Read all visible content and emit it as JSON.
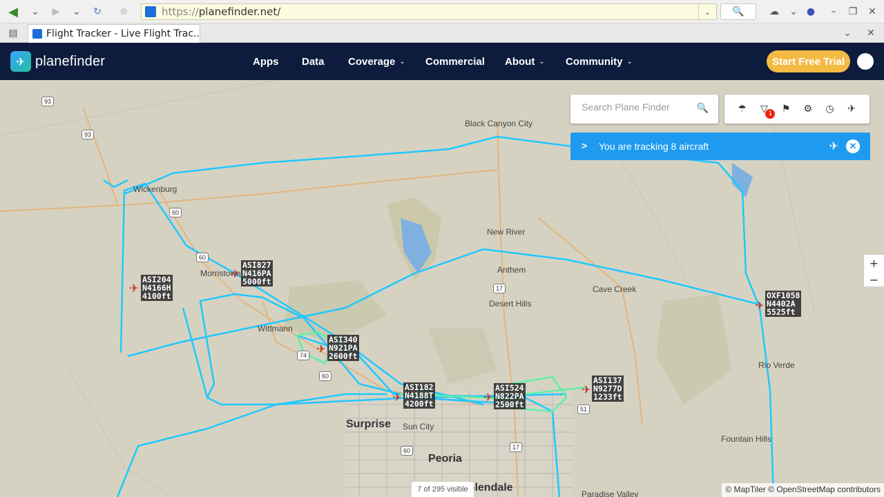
{
  "browser": {
    "url_prefix": "https://",
    "url_host": "planefinder.net/",
    "tab_title": "Flight Tracker - Live Flight Trac..."
  },
  "nav": {
    "logo": "planefinder",
    "items": [
      "Apps",
      "Data",
      "Coverage",
      "Commercial",
      "About",
      "Community"
    ],
    "trial_button": "Start Free Trial"
  },
  "map": {
    "search_placeholder": "Search Plane Finder",
    "notification_count": "1",
    "tracking_text": "You are tracking 8 aircraft",
    "zoom_in": "+",
    "zoom_out": "−",
    "visible_count": "7 of 295 visible",
    "attribution": "© MapTiler © OpenStreetMap contributors",
    "places": [
      "Black Canyon City",
      "Wickenburg",
      "New River",
      "Anthem",
      "Desert Hills",
      "Cave Creek",
      "Morristown",
      "Wittmann",
      "Rio Verde",
      "Surprise",
      "Sun City",
      "Peoria",
      "Fountain Hills",
      "Glendale",
      "Paradise Valley"
    ],
    "aircraft": [
      {
        "callsign": "ASI204",
        "reg": "N4166H",
        "alt": "4100ft"
      },
      {
        "callsign": "ASI827",
        "reg": "N416PA",
        "alt": "5000ft"
      },
      {
        "callsign": "ASI340",
        "reg": "N921PA",
        "alt": "2600ft"
      },
      {
        "callsign": "ASI182",
        "reg": "N4188T",
        "alt": "4200ft"
      },
      {
        "callsign": "ASI524",
        "reg": "N822PA",
        "alt": "2500ft"
      },
      {
        "callsign": "ASI137",
        "reg": "N9277D",
        "alt": "1233ft"
      },
      {
        "callsign": "OXF1058",
        "reg": "N4402A",
        "alt": "5525ft"
      }
    ]
  },
  "colors": {
    "nav_bg": "#0d1b3c",
    "track": "#1e9bf0",
    "trial": "#f4bb44",
    "flight_path": "#1fc8ff"
  }
}
